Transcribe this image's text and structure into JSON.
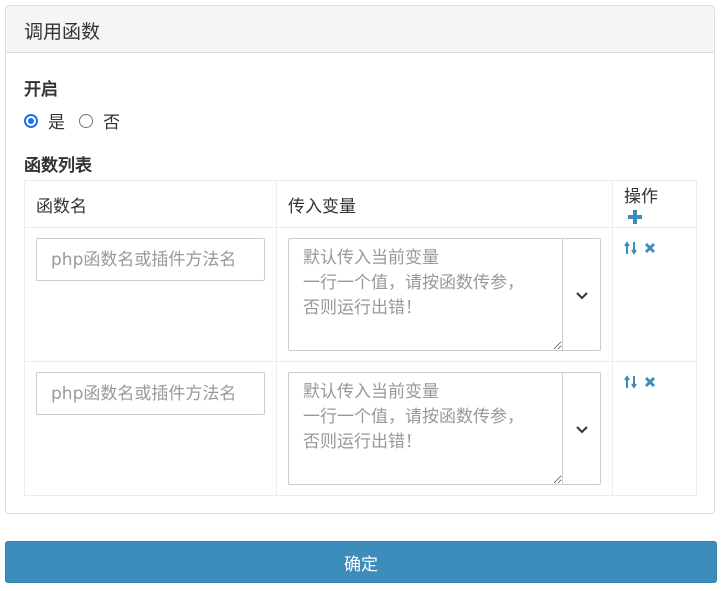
{
  "panel": {
    "title": "调用函数"
  },
  "enable": {
    "label": "开启",
    "options": [
      {
        "label": "是",
        "checked": true
      },
      {
        "label": "否",
        "checked": false
      }
    ]
  },
  "function_list": {
    "label": "函数列表",
    "headers": {
      "name": "函数名",
      "vars": "传入变量",
      "ops": "操作"
    },
    "rows": [
      {
        "name_placeholder": "php函数名或插件方法名",
        "vars_placeholder": "默认传入当前变量\n一行一个值，请按函数传参，\n否则运行出错！"
      },
      {
        "name_placeholder": "php函数名或插件方法名",
        "vars_placeholder": "默认传入当前变量\n一行一个值，请按函数传参，\n否则运行出错！"
      }
    ]
  },
  "submit": {
    "label": "确定"
  },
  "colors": {
    "accent": "#3c8dbc",
    "radio": "#1a73e8",
    "border": "#dddddd"
  },
  "icons": [
    "plus-icon",
    "sort-icon",
    "remove-icon",
    "chevron-down-icon"
  ]
}
